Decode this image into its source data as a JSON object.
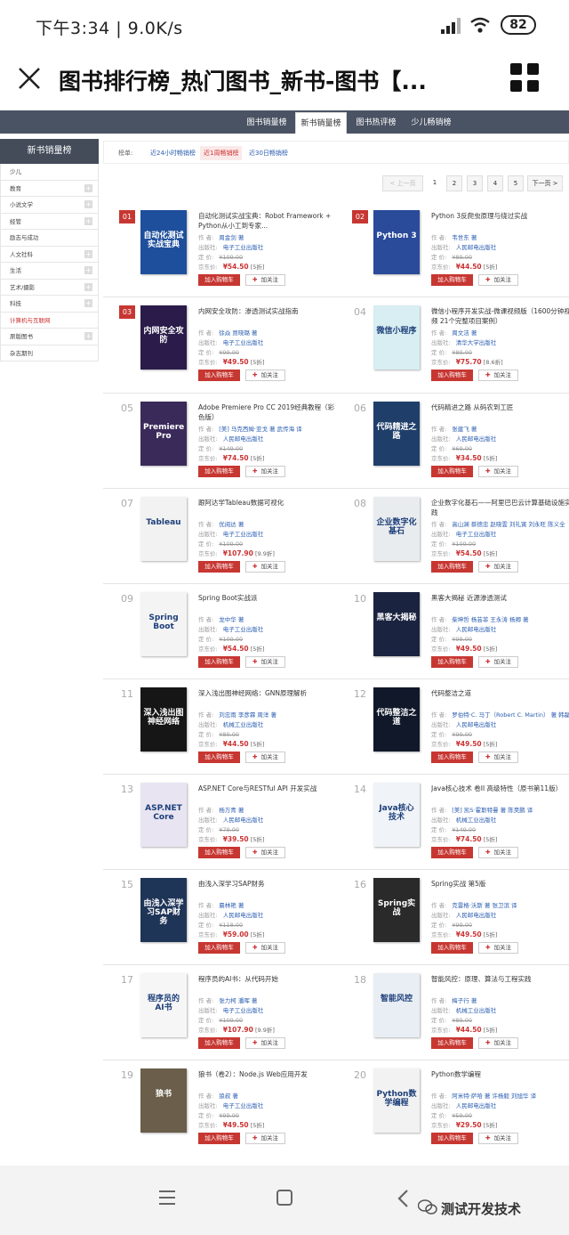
{
  "status": {
    "time": "下午3:34 | 9.0K/s",
    "battery": "82"
  },
  "titlebar": {
    "title": "图书排行榜_热门图书_新书-图书【..."
  },
  "top_tabs": [
    "图书销量榜",
    "新书销量榜",
    "图书热评榜",
    "少儿畅销榜"
  ],
  "left_nav": {
    "header": "新书销量榜",
    "items": [
      {
        "label": "少儿",
        "plus": false,
        "red": false
      },
      {
        "label": "教育",
        "plus": true,
        "red": false
      },
      {
        "label": "小说文学",
        "plus": true,
        "red": false
      },
      {
        "label": "经管",
        "plus": true,
        "red": false
      },
      {
        "label": "励志与成功",
        "plus": false,
        "red": false
      },
      {
        "label": "人文社科",
        "plus": true,
        "red": false
      },
      {
        "label": "生活",
        "plus": true,
        "red": false
      },
      {
        "label": "艺术/摄影",
        "plus": true,
        "red": false
      },
      {
        "label": "科技",
        "plus": true,
        "red": false
      },
      {
        "label": "计算机与互联网",
        "plus": false,
        "red": true
      },
      {
        "label": "原版图书",
        "plus": true,
        "red": false
      },
      {
        "label": "杂志期刊",
        "plus": false,
        "red": false
      }
    ]
  },
  "filter": {
    "label": "榜单:",
    "options": [
      "近24小时畅销榜",
      "近1周畅销榜",
      "近30日畅销榜"
    ],
    "selected": 1
  },
  "pager": {
    "prev": "< 上一页",
    "pages": [
      "1",
      "2",
      "3",
      "4",
      "5"
    ],
    "current": "1",
    "next": "下一页 >"
  },
  "labels": {
    "author": "作 者:",
    "publisher": "出版社:",
    "price": "定 价:",
    "jd_price": "京东价:",
    "cart": "加入购物车",
    "fav": "加关注"
  },
  "books": [
    {
      "rank": "01",
      "title": "自动化测试实战宝典：Robot Framework + Python从小工到专家...",
      "author": "周金剑 著",
      "publisher": "电子工业出版社",
      "price": "¥109.00",
      "jd": "¥54.50",
      "disc": "[5折]",
      "cover_text": "自动化测试实战宝典",
      "cover_color": "#1e4f9c"
    },
    {
      "rank": "02",
      "title": "Python 3反爬虫原理与绕过实战",
      "author": "韦世东 著",
      "publisher": "人民邮电出版社",
      "price": "¥89.00",
      "jd": "¥44.50",
      "disc": "[5折]",
      "cover_text": "Python 3",
      "cover_color": "#2a4a9a"
    },
    {
      "rank": "03",
      "title": "内网安全攻防：渗透测试实战指南",
      "author": "徐焱 贾晓璐 著",
      "publisher": "电子工业出版社",
      "price": "¥99.00",
      "jd": "¥49.50",
      "disc": "[5折]",
      "cover_text": "内网安全攻防",
      "cover_color": "#2a1b4a"
    },
    {
      "rank": "04",
      "title": "微信小程序开发实战-微课视频版（1600分钟视频 21个完整项目案例）",
      "author": "周文洁 著",
      "publisher": "清华大学出版社",
      "price": "¥89.00",
      "jd": "¥75.70",
      "disc": "[8.6折]",
      "cover_text": "微信小程序",
      "cover_color": "#d8eef2"
    },
    {
      "rank": "05",
      "title": "Adobe Premiere Pro CC 2019经典教程（彩色版）",
      "author": "[美] 马克西姆·亚戈 著 武传海 译",
      "publisher": "人民邮电出版社",
      "price": "¥149.00",
      "jd": "¥74.50",
      "disc": "[5折]",
      "cover_text": "Premiere Pro",
      "cover_color": "#3a2a5a"
    },
    {
      "rank": "06",
      "title": "代码精进之路 从码农到工匠",
      "author": "张建飞 著",
      "publisher": "人民邮电出版社",
      "price": "¥69.00",
      "jd": "¥34.50",
      "disc": "[5折]",
      "cover_text": "代码精进之路",
      "cover_color": "#1f3f6a"
    },
    {
      "rank": "07",
      "title": "跟阿达学Tableau数据可视化",
      "author": "优阅达 著",
      "publisher": "电子工业出版社",
      "price": "¥109.00",
      "jd": "¥107.90",
      "disc": "[9.9折]",
      "cover_text": "Tableau",
      "cover_color": "#f2f2f2"
    },
    {
      "rank": "08",
      "title": "企业数字化基石——阿里巴巴云计算基础设施实践",
      "author": "高山渊 蔡德忠 赵晓雲 刘礼寅 刘永旺 陈义全",
      "publisher": "电子工业出版社",
      "price": "¥109.00",
      "jd": "¥54.50",
      "disc": "[5折]",
      "cover_text": "企业数字化基石",
      "cover_color": "#e9ecef"
    },
    {
      "rank": "09",
      "title": "Spring Boot实战派",
      "author": "龙中华 著",
      "publisher": "电子工业出版社",
      "price": "¥109.00",
      "jd": "¥54.50",
      "disc": "[5折]",
      "cover_text": "Spring Boot",
      "cover_color": "#f4f4f4"
    },
    {
      "rank": "10",
      "title": "黑客大揭秘 近源渗透测试",
      "author": "柴坤哲 杨芸菲 王永涛 杨卿 著",
      "publisher": "人民邮电出版社",
      "price": "¥99.00",
      "jd": "¥49.50",
      "disc": "[5折]",
      "cover_text": "黑客大揭秘",
      "cover_color": "#1a2440"
    },
    {
      "rank": "11",
      "title": "深入浅出图神经网络：GNN原理解析",
      "author": "刘忠雨 李彦霖 周洋 著",
      "publisher": "机械工业出版社",
      "price": "¥89.00",
      "jd": "¥44.50",
      "disc": "[5折]",
      "cover_text": "深入浅出图神经网络",
      "cover_color": "#161616"
    },
    {
      "rank": "12",
      "title": "代码整洁之道",
      "author": "罗伯特·C. 马丁（Robert C. Martin） 著 韩磊",
      "publisher": "人民邮电出版社",
      "price": "¥99.00",
      "jd": "¥49.50",
      "disc": "[5折]",
      "cover_text": "代码整洁之道",
      "cover_color": "#10182a"
    },
    {
      "rank": "13",
      "title": "ASP.NET Core与RESTful API 开发实战",
      "author": "杨万青 著",
      "publisher": "人民邮电出版社",
      "price": "¥79.00",
      "jd": "¥39.50",
      "disc": "[5折]",
      "cover_text": "ASP.NET Core",
      "cover_color": "#e8e4f2"
    },
    {
      "rank": "14",
      "title": "Java核心技术 卷II 高级特性（原书第11版）",
      "author": "[美] 凯S·霍斯特曼 著 陈昊鹏 译",
      "publisher": "机械工业出版社",
      "price": "¥149.00",
      "jd": "¥74.50",
      "disc": "[5折]",
      "cover_text": "Java核心技术",
      "cover_color": "#f0f3f7"
    },
    {
      "rank": "15",
      "title": "由浅入深学习SAP财务",
      "author": "晨林艳 著",
      "publisher": "人民邮电出版社",
      "price": "¥118.00",
      "jd": "¥59.00",
      "disc": "[5折]",
      "cover_text": "由浅入深学习SAP财务",
      "cover_color": "#1f3558"
    },
    {
      "rank": "16",
      "title": "Spring实战 第5版",
      "author": "克雷格·沃斯 著 张卫滨 译",
      "publisher": "人民邮电出版社",
      "price": "¥99.00",
      "jd": "¥49.50",
      "disc": "[5折]",
      "cover_text": "Spring实战",
      "cover_color": "#2a2a2a"
    },
    {
      "rank": "17",
      "title": "程序员的AI书：从代码开始",
      "author": "张力柯 潘晖 著",
      "publisher": "电子工业出版社",
      "price": "¥109.00",
      "jd": "¥107.90",
      "disc": "[9.9折]",
      "cover_text": "程序员的AI书",
      "cover_color": "#f6f6f6"
    },
    {
      "rank": "18",
      "title": "智能风控：原理、算法与工程实践",
      "author": "梅子行 著",
      "publisher": "机械工业出版社",
      "price": "¥89.00",
      "jd": "¥44.50",
      "disc": "[5折]",
      "cover_text": "智能风控",
      "cover_color": "#e9eef4"
    },
    {
      "rank": "19",
      "title": "狼书（卷2）：Node.js Web应用开发",
      "author": "狼叔 著",
      "publisher": "电子工业出版社",
      "price": "¥99.00",
      "jd": "¥49.50",
      "disc": "[5折]",
      "cover_text": "狼书",
      "cover_color": "#6b5e4a"
    },
    {
      "rank": "20",
      "title": "Python数学编程",
      "author": "阿米特·萨哈 著 许杨毅 刘旭华 译",
      "publisher": "人民邮电出版社",
      "price": "¥59.00",
      "jd": "¥29.50",
      "disc": "[5折]",
      "cover_text": "Python数学编程",
      "cover_color": "#f2f2f2"
    }
  ],
  "watermark": "测试开发技术"
}
